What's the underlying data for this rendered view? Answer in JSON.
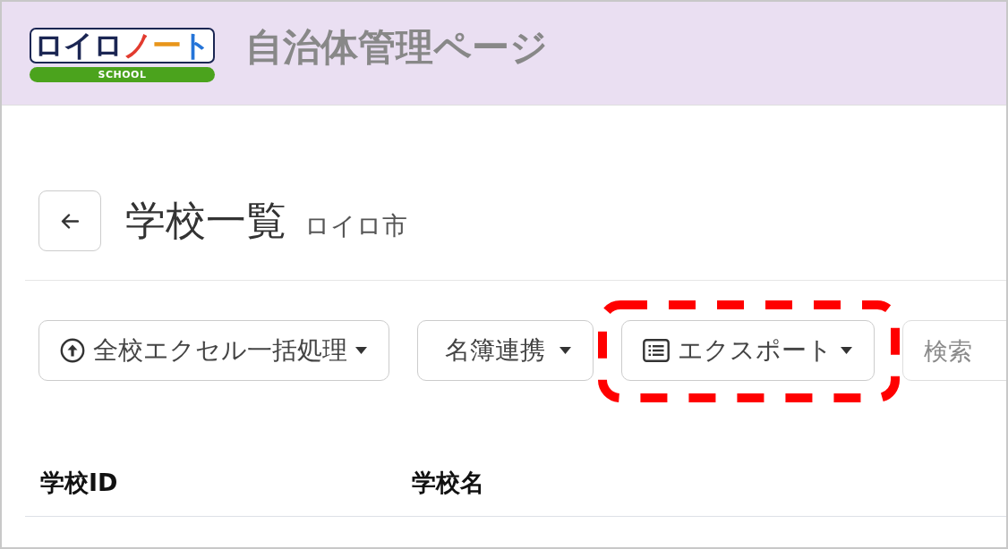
{
  "header": {
    "logo": {
      "wordmark": "ロイロノート",
      "tagline": "SCHOOL"
    },
    "title": "自治体管理ページ"
  },
  "page": {
    "title": "学校一覧",
    "subtitle": "ロイロ市"
  },
  "toolbar": {
    "buttons": [
      {
        "label": "全校エクセル一括処理",
        "highlighted": false
      },
      {
        "label": "名簿連携",
        "highlighted": false
      },
      {
        "label": "エクスポート",
        "highlighted": true
      }
    ],
    "search": {
      "placeholder": "検索"
    }
  },
  "table": {
    "columns": [
      "学校ID",
      "学校名"
    ]
  }
}
